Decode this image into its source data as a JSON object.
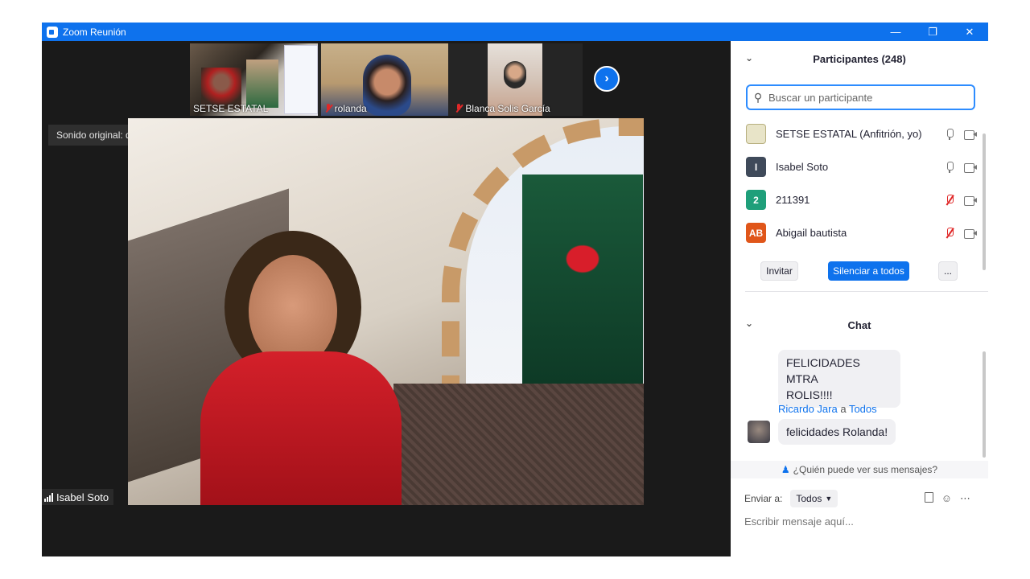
{
  "window": {
    "title": "Zoom Reunión"
  },
  "thumbnails": [
    {
      "name": "SETSE ESTATAL",
      "muted": false
    },
    {
      "name": "rolanda",
      "muted": true
    },
    {
      "name": "Blanca Solis García",
      "muted": true
    }
  ],
  "stage": {
    "sound_label": "Sonido original: desactivado",
    "speaker_name": "Isabel Soto"
  },
  "participants": {
    "title": "Participantes (248)",
    "search_placeholder": "Buscar un participante",
    "list": [
      {
        "name": "SETSE ESTATAL (Anfitrión, yo)",
        "avatar_text": "",
        "avatar_color": "#e8e4c8",
        "mic_muted": false
      },
      {
        "name": "Isabel Soto",
        "avatar_text": "I",
        "avatar_color": "#3f4a5a",
        "mic_muted": false
      },
      {
        "name": "211391",
        "avatar_text": "2",
        "avatar_color": "#1f9f7a",
        "mic_muted": true
      },
      {
        "name": "Abigail bautista",
        "avatar_text": "AB",
        "avatar_color": "#e0561a",
        "mic_muted": true
      }
    ],
    "invite_label": "Invitar",
    "mute_all_label": "Silenciar a todos",
    "more_label": "..."
  },
  "chat": {
    "title": "Chat",
    "messages": [
      {
        "text_line1": "FELICIDADES MTRA",
        "text_line2": "ROLIS!!!!"
      },
      {
        "sender": "Ricardo Jara",
        "to_word": "a",
        "to": "Todos",
        "text": "felicidades Rolanda!"
      }
    ],
    "who_can_see": "¿Quién puede ver sus mensajes?",
    "send_to_label": "Enviar a:",
    "send_to_value": "Todos",
    "input_placeholder": "Escribir mensaje aquí..."
  }
}
